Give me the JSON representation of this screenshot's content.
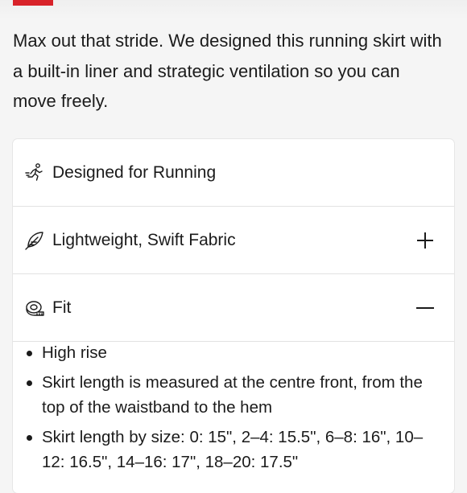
{
  "accent_color": "#d8232a",
  "description": "Max out that stride. We designed this running skirt with a built-in liner and strategic ventilation so you can move freely.",
  "features": [
    {
      "label": "Designed for Running",
      "icon": "runner-icon",
      "expandable": false
    },
    {
      "label": "Lightweight, Swift Fabric",
      "icon": "feather-icon",
      "toggle": "+",
      "expanded": false
    },
    {
      "label": "Fit",
      "icon": "measuring-tape-icon",
      "toggle": "−",
      "expanded": true
    }
  ],
  "fit_details": [
    "High rise",
    "Skirt length is measured at the centre front, from the top of the waistband to the hem",
    "Skirt length by size: 0: 15\", 2–4: 15.5\", 6–8: 16\", 10–12: 16.5\", 14–16: 17\", 18–20: 17.5\""
  ]
}
